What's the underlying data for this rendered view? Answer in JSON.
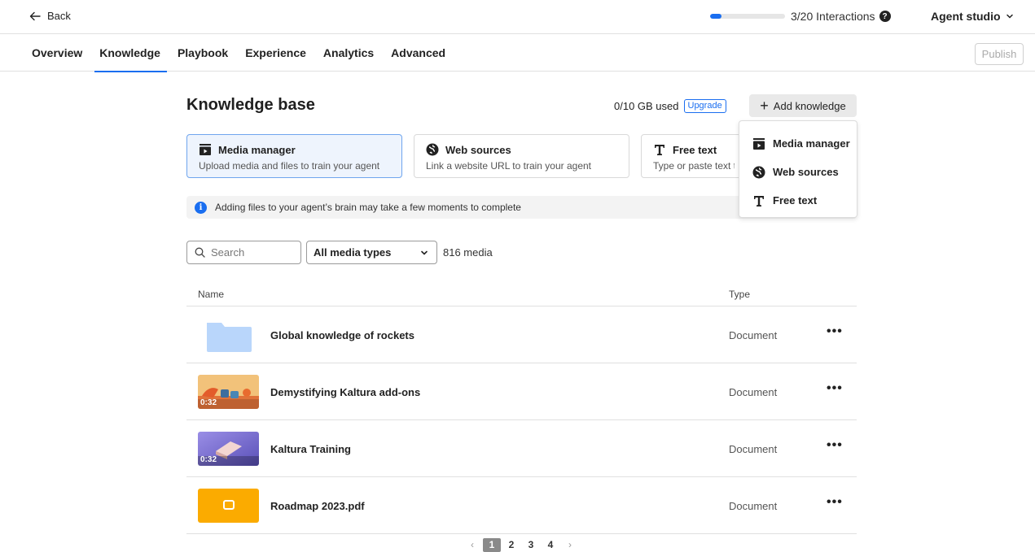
{
  "topbar": {
    "back_label": "Back",
    "interactions_label": "3/20 Interactions",
    "interactions_progress": 0.15,
    "help_icon": "?",
    "studio_label": "Agent studio"
  },
  "nav": {
    "tabs": [
      {
        "label": "Overview"
      },
      {
        "label": "Knowledge"
      },
      {
        "label": "Playbook"
      },
      {
        "label": "Experience"
      },
      {
        "label": "Analytics"
      },
      {
        "label": "Advanced"
      }
    ],
    "active_tab": "Knowledge",
    "publish_label": "Publish"
  },
  "main": {
    "title": "Knowledge base",
    "usage": "0/10 GB used",
    "upgrade_label": "Upgrade",
    "add_knowledge_label": "Add knowledge",
    "sources": [
      {
        "title": "Media manager",
        "desc": "Upload media and files to train your agent",
        "icon": "media-icon"
      },
      {
        "title": "Web sources",
        "desc": "Link a website URL to train your agent",
        "icon": "globe-icon"
      },
      {
        "title": "Free text",
        "desc": "Type or paste text to",
        "icon": "text-icon"
      }
    ],
    "info_message": "Adding files to your agent’s brain may take a few moments to complete",
    "search_placeholder": "Search",
    "media_type_selected": "All media types",
    "media_count": "816 media"
  },
  "table": {
    "col_name": "Name",
    "col_type": "Type",
    "rows": [
      {
        "name": "Global knowledge of rockets",
        "type": "Document",
        "thumb": "folder",
        "duration": ""
      },
      {
        "name": "Demystifying Kaltura add-ons",
        "type": "Document",
        "thumb": "video-orange",
        "duration": "0:32"
      },
      {
        "name": "Kaltura Training",
        "type": "Document",
        "thumb": "video-purple",
        "duration": "0:32"
      },
      {
        "name": "Roadmap 2023.pdf",
        "type": "Document",
        "thumb": "pdf",
        "duration": ""
      }
    ]
  },
  "pagination": {
    "prev": "‹",
    "pages": [
      "1",
      "2",
      "3",
      "4"
    ],
    "current": "1",
    "next": "›"
  },
  "dropdown": {
    "items": [
      {
        "label": "Media manager",
        "icon": "media-icon"
      },
      {
        "label": "Web sources",
        "icon": "globe-icon"
      },
      {
        "label": "Free text",
        "icon": "text-icon"
      }
    ]
  },
  "colors": {
    "accent": "#1a6ef0",
    "selected_card_bg": "#eef4fd",
    "folder": "#b9d6fb",
    "pdf": "#fbab00"
  }
}
